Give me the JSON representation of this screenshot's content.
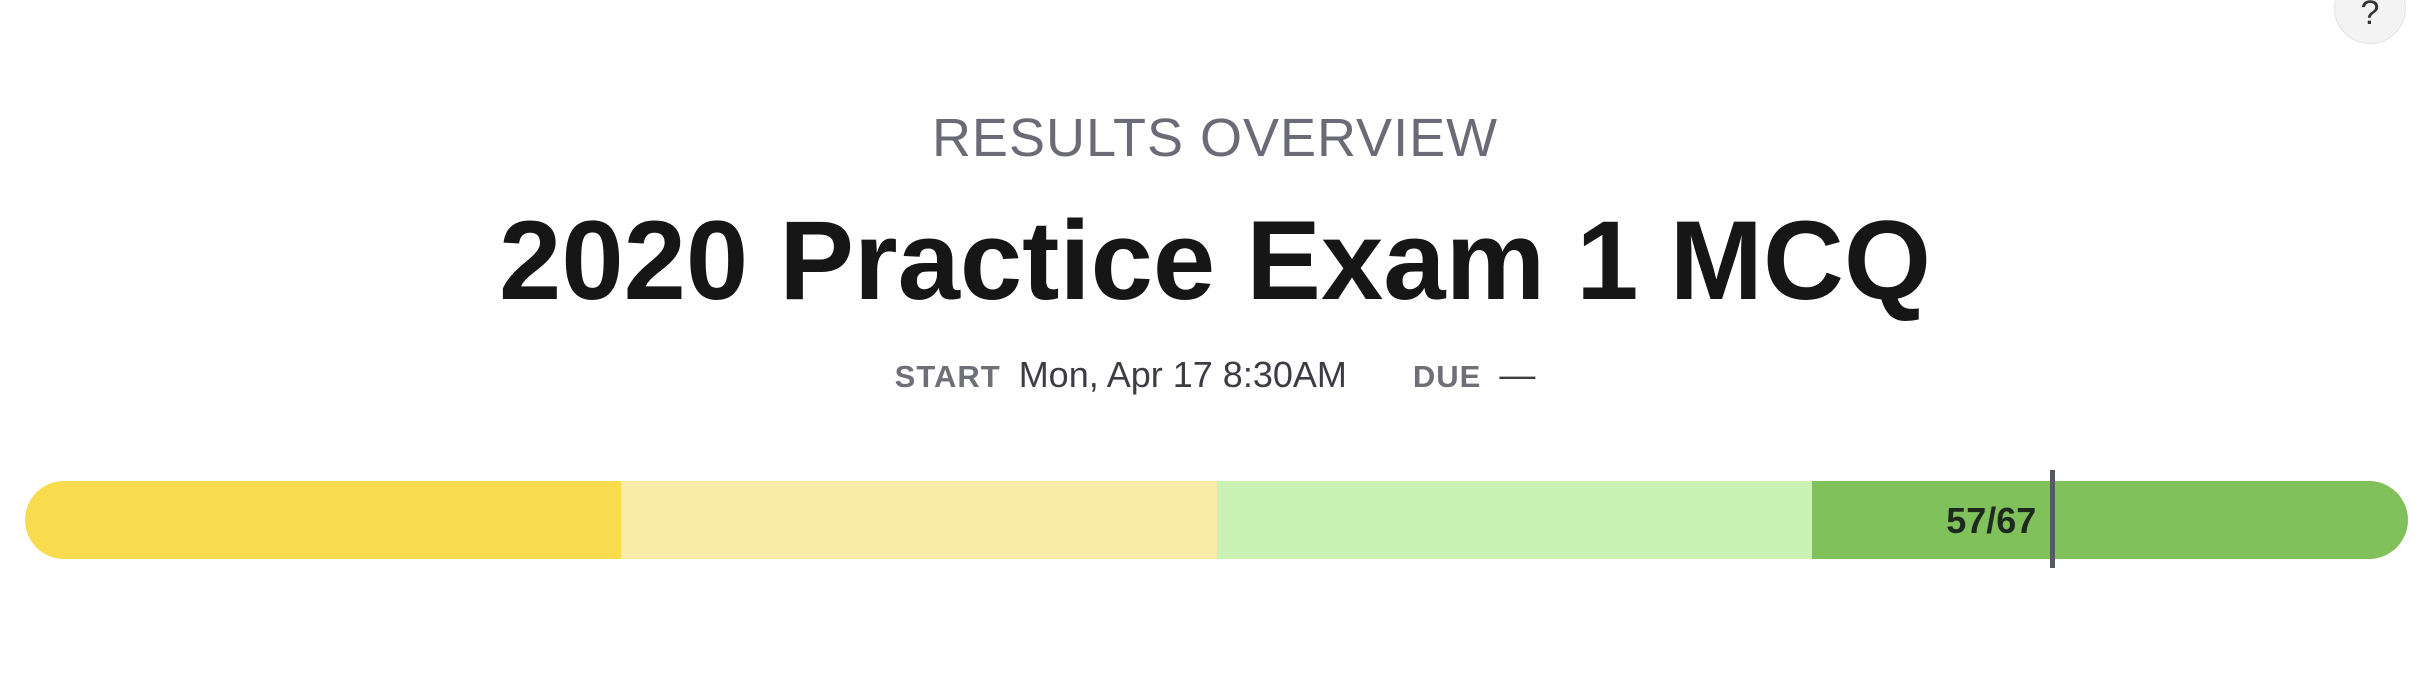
{
  "header": {
    "help_label": "?",
    "eyebrow": "RESULTS OVERVIEW",
    "title": "2020 Practice Exam 1 MCQ"
  },
  "meta": {
    "start_label": "START",
    "start_value": "Mon, Apr 17 8:30AM",
    "due_label": "DUE",
    "due_value": "—"
  },
  "score": {
    "label": "57/67",
    "correct": 57,
    "total": 67,
    "fraction": 0.8507
  },
  "progress_bar": {
    "segments": [
      {
        "name": "band-1",
        "color": "#f8dc4d",
        "fraction": 0.25
      },
      {
        "name": "band-2",
        "color": "#fbeba8",
        "fraction": 0.25
      },
      {
        "name": "band-3",
        "color": "#caf2b4",
        "fraction": 0.25
      },
      {
        "name": "band-4",
        "color": "#80c15b",
        "fraction": 0.25
      }
    ],
    "marker_color": "#555a5f"
  }
}
